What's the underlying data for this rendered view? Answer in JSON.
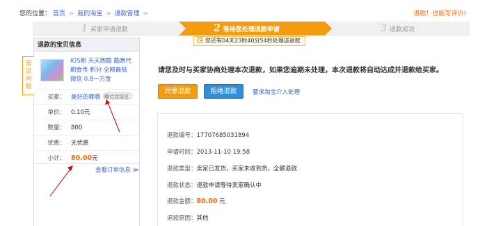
{
  "breadcrumb": {
    "prefix": "您的位置：",
    "items": [
      "首页",
      "我的淘宝",
      "退款管理"
    ],
    "sep": ">"
  },
  "top_right": "退款！也能写评价!",
  "steps": [
    {
      "num": "1",
      "label": "买家申请退款",
      "state": "done"
    },
    {
      "num": "2",
      "label": "等待您处理退款申请",
      "state": "active"
    },
    {
      "num": "3",
      "label": "退款成功",
      "state": "todo"
    }
  ],
  "timer": "您还有04天23时40分54秒处理该退款",
  "faq_tab": "常见问题",
  "panel": {
    "title": "退款的宝贝信息",
    "product_title": "IOS新 天天跑酷 酷跑代刷金币 积分 全网最低 微信 0.8一万金",
    "rows": {
      "seller_key": "买家：",
      "seller_val": "美好的椰蓉",
      "ww_label": "给我留言",
      "price_key": "单价：",
      "price_val": "0.10元",
      "qty_key": "数量：",
      "qty_val": "800",
      "disc_key": "优惠：",
      "disc_val": "无优惠",
      "sub_key": "小计：",
      "sub_val": "80.00",
      "sub_unit": "元"
    },
    "view_order": "查看订单信息 ≫"
  },
  "main": {
    "message": "请您及时与买家协商处理本次退款，如果您逾期未处理，本次退款将自动达成并退款给买家。",
    "agree_btn": "同意退款",
    "reject_btn": "拒绝退款",
    "request_taobao": "要求淘宝介入处理"
  },
  "info": {
    "refund_no_key": "退款编号：",
    "refund_no": "17707685031894",
    "apply_time_key": "申请时间：",
    "apply_time": "2013-11-10 19:58",
    "type_key": "退款类型：",
    "type": "卖家已发货，买家未收到货，全额退款",
    "status_key": "退款状态：",
    "status": "退款申请等待卖家确认中",
    "amount_key": "退款金额：",
    "amount": "80.00",
    "amount_unit": "元",
    "reason_key": "退款原因：",
    "reason": "其他"
  },
  "colors": {
    "accent": "#f39c12",
    "link": "#3366cc",
    "primary_btn": "#2f8ed8",
    "price": "#ff6600"
  }
}
